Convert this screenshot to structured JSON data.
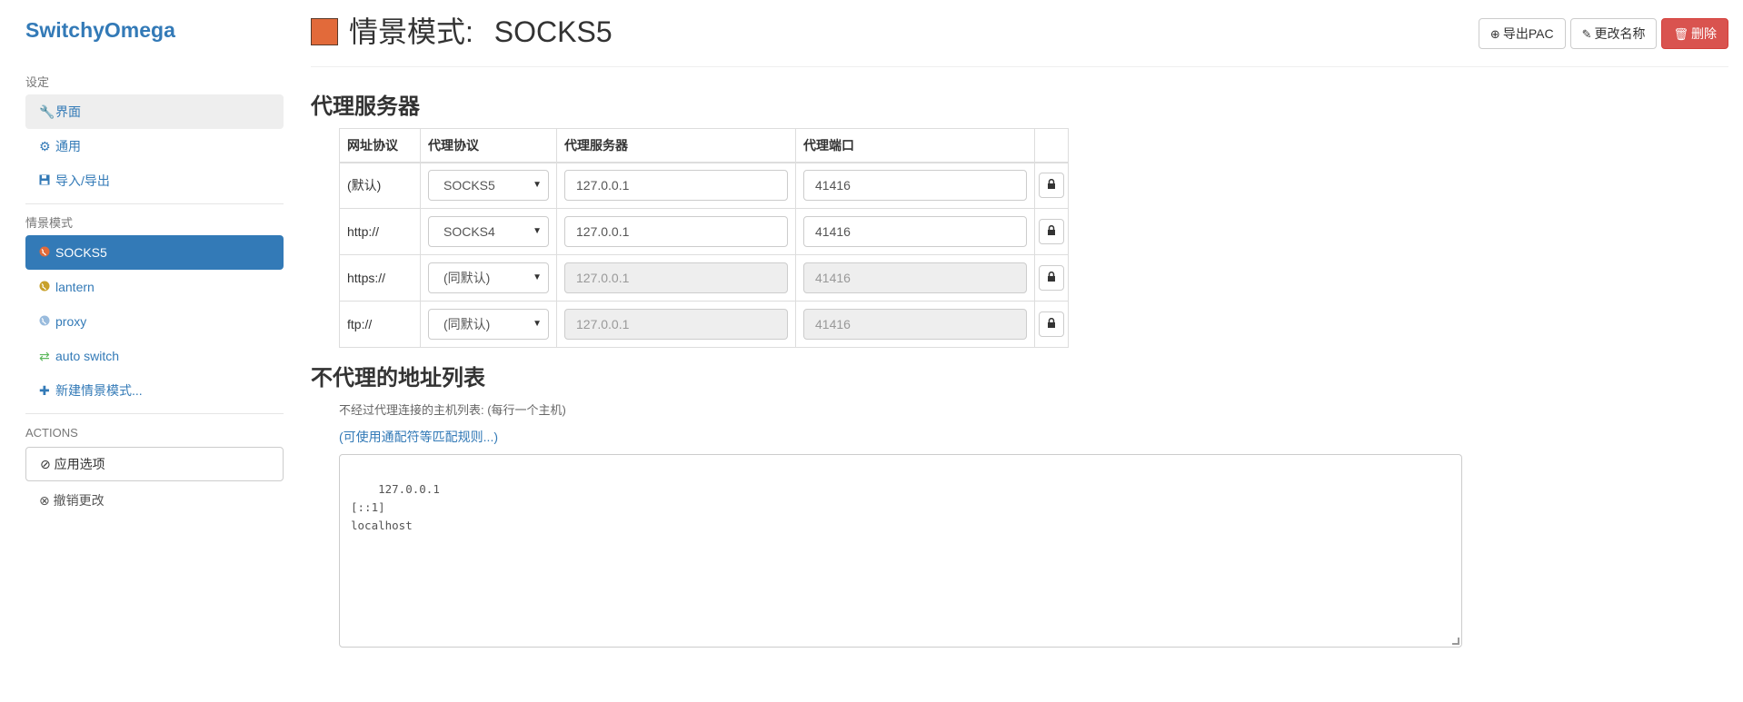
{
  "app": {
    "brand": "SwitchyOmega"
  },
  "sidebar": {
    "settings_header": "设定",
    "settings_items": [
      {
        "label": "界面",
        "icon": "wrench-icon"
      },
      {
        "label": "通用",
        "icon": "gear-icon"
      },
      {
        "label": "导入/导出",
        "icon": "floppy-icon"
      }
    ],
    "profiles_header": "情景模式",
    "profiles": [
      {
        "label": "SOCKS5",
        "icon": "globe-icon",
        "color": "#e26a3a"
      },
      {
        "label": "lantern",
        "icon": "globe-icon",
        "color": "#c8a12a"
      },
      {
        "label": "proxy",
        "icon": "globe-icon",
        "color": "#99bbdd"
      },
      {
        "label": "auto switch",
        "icon": "retweet-icon",
        "color": "#5cb85c"
      },
      {
        "label": "新建情景模式...",
        "icon": "plus-icon"
      }
    ],
    "actions_header": "ACTIONS",
    "apply_label": "应用选项",
    "discard_label": "撤销更改"
  },
  "header": {
    "profile_color": "#e26a3a",
    "title_prefix": "情景模式:",
    "title_name": "SOCKS5",
    "export_pac_label": "导出PAC",
    "rename_label": "更改名称",
    "delete_label": "删除"
  },
  "proxy_section": {
    "title": "代理服务器",
    "columns": [
      "网址协议",
      "代理协议",
      "代理服务器",
      "代理端口"
    ],
    "rows": [
      {
        "scheme": "(默认)",
        "protocol": "SOCKS5",
        "server": "127.0.0.1",
        "port": "41416",
        "disabled": false
      },
      {
        "scheme": "http://",
        "protocol": "SOCKS4",
        "server": "127.0.0.1",
        "port": "41416",
        "disabled": false
      },
      {
        "scheme": "https://",
        "protocol": "(同默认)",
        "server": "127.0.0.1",
        "port": "41416",
        "disabled": true
      },
      {
        "scheme": "ftp://",
        "protocol": "(同默认)",
        "server": "127.0.0.1",
        "port": "41416",
        "disabled": true
      }
    ]
  },
  "bypass_section": {
    "title": "不代理的地址列表",
    "help_text": "不经过代理连接的主机列表: (每行一个主机)",
    "help_link": "(可使用通配符等匹配规则...)",
    "list": "127.0.0.1\n[::1]\nlocalhost"
  },
  "colors": {
    "accent": "#337ab7",
    "danger": "#d9534f"
  }
}
